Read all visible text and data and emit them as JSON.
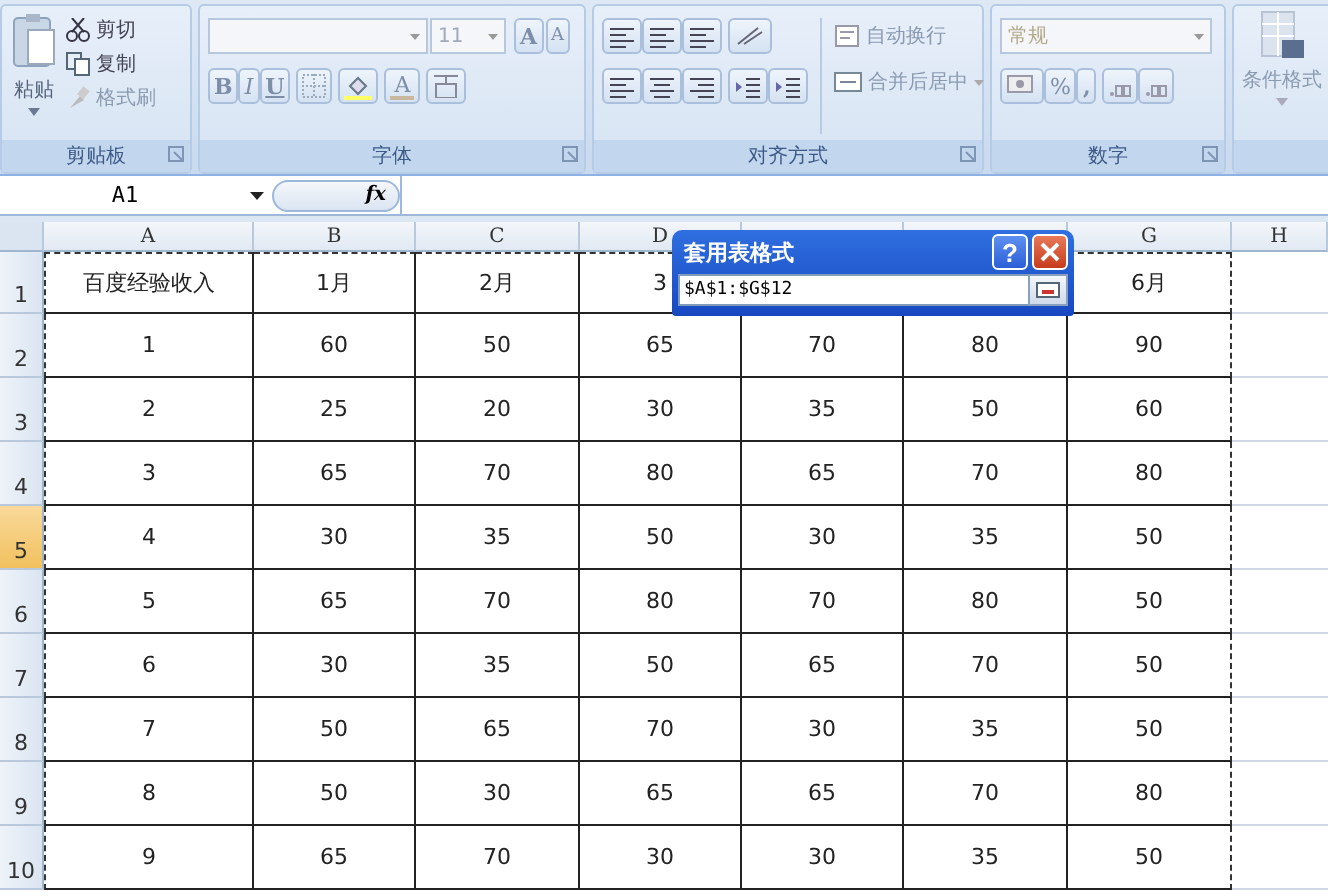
{
  "ribbon": {
    "groups": [
      {
        "kind": "clipboard",
        "label": "剪贴板",
        "paste": "粘贴",
        "items": [
          "剪切",
          "复制",
          "格式刷"
        ]
      },
      {
        "kind": "font",
        "label": "字体",
        "font_size": "11",
        "grow": "A",
        "shrink": "A",
        "styles": [
          "B",
          "I",
          "U"
        ],
        "font_color": "A"
      },
      {
        "kind": "align",
        "label": "对齐方式",
        "wrap": "自动换行",
        "merge": "合并后居中"
      },
      {
        "kind": "number",
        "label": "数字",
        "format": "常规",
        "percent": "%",
        "comma": ","
      },
      {
        "kind": "styles",
        "conditional": "条件格式"
      }
    ]
  },
  "formula_bar": {
    "name_box": "A1",
    "fx": "fx"
  },
  "sheet": {
    "columns": [
      {
        "label": "A"
      },
      {
        "label": "B"
      },
      {
        "label": "C"
      },
      {
        "label": "D"
      },
      {},
      {},
      {
        "label": "G"
      },
      {
        "label": "H"
      }
    ],
    "rows": [
      {
        "number": "1",
        "selected": false,
        "cells": [
          "百度经验收入",
          "1月",
          "2月",
          "3",
          null,
          null,
          "6月"
        ]
      },
      {
        "number": "2",
        "selected": false,
        "cells": [
          "1",
          "60",
          "50",
          "65",
          "70",
          "80",
          "90"
        ]
      },
      {
        "number": "3",
        "selected": false,
        "cells": [
          "2",
          "25",
          "20",
          "30",
          "35",
          "50",
          "60"
        ]
      },
      {
        "number": "4",
        "selected": false,
        "cells": [
          "3",
          "65",
          "70",
          "80",
          "65",
          "70",
          "80"
        ]
      },
      {
        "number": "5",
        "selected": true,
        "cells": [
          "4",
          "30",
          "35",
          "50",
          "30",
          "35",
          "50"
        ]
      },
      {
        "number": "6",
        "selected": false,
        "cells": [
          "5",
          "65",
          "70",
          "80",
          "70",
          "80",
          "50"
        ]
      },
      {
        "number": "7",
        "selected": false,
        "cells": [
          "6",
          "30",
          "35",
          "50",
          "65",
          "70",
          "50"
        ]
      },
      {
        "number": "8",
        "selected": false,
        "cells": [
          "7",
          "50",
          "65",
          "70",
          "30",
          "35",
          "50"
        ]
      },
      {
        "number": "9",
        "selected": false,
        "cells": [
          "8",
          "50",
          "30",
          "65",
          "65",
          "70",
          "80"
        ]
      },
      {
        "number": "10",
        "selected": false,
        "cells": [
          "9",
          "65",
          "70",
          "30",
          "30",
          "35",
          "50"
        ]
      }
    ]
  },
  "dialog": {
    "title": "套用表格式",
    "help": "?",
    "range": "$A$1:$G$12"
  }
}
